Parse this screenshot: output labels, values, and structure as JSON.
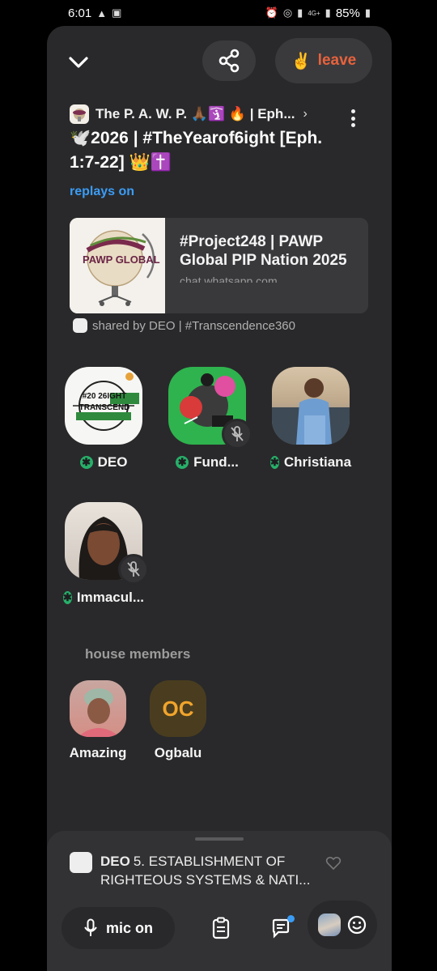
{
  "status": {
    "time": "6:01",
    "network": "4G+",
    "battery": "85%"
  },
  "colors": {
    "accent_leave": "#e8623c",
    "link_blue": "#3b9cf5",
    "moderator_green": "#27b06a",
    "sheet_bg": "#29292b"
  },
  "top": {
    "leave_emoji": "✌️",
    "leave_label": "leave",
    "close_icon": "chevron-down-icon",
    "share_icon": "share-icon"
  },
  "room": {
    "club_name": "The P. A. W. P. 🙏🏾🛐 🔥 | Eph...",
    "title": "🕊️2026 | #TheYearof6ight [Eph. 1:7-22] 👑✝️",
    "replays": "replays on"
  },
  "link_card": {
    "thumb_text": "PAWP GLOBAL",
    "title": "#Project248 | PAWP Global PIP Nation 2025",
    "url": "chat.whatsapp.com"
  },
  "shared_by": "shared by DEO | #Transcendence360",
  "speakers": [
    {
      "name": "DEO",
      "muted": false,
      "avatar_text": "#20 26IGHT TRANSCEND"
    },
    {
      "name": "Fund...",
      "muted": true
    },
    {
      "name": "Christiana",
      "muted": false
    },
    {
      "name": "Immacul...",
      "muted": true
    }
  ],
  "members_section": "house members",
  "members": [
    {
      "name": "Amazing",
      "initials": ""
    },
    {
      "name": "Ogbalu",
      "initials": "OC"
    }
  ],
  "chat": {
    "author": "DEO",
    "message": "5. ESTABLISHMENT OF RIGHTEOUS SYSTEMS & NATI..."
  },
  "controls": {
    "mic_label": "mic on"
  }
}
